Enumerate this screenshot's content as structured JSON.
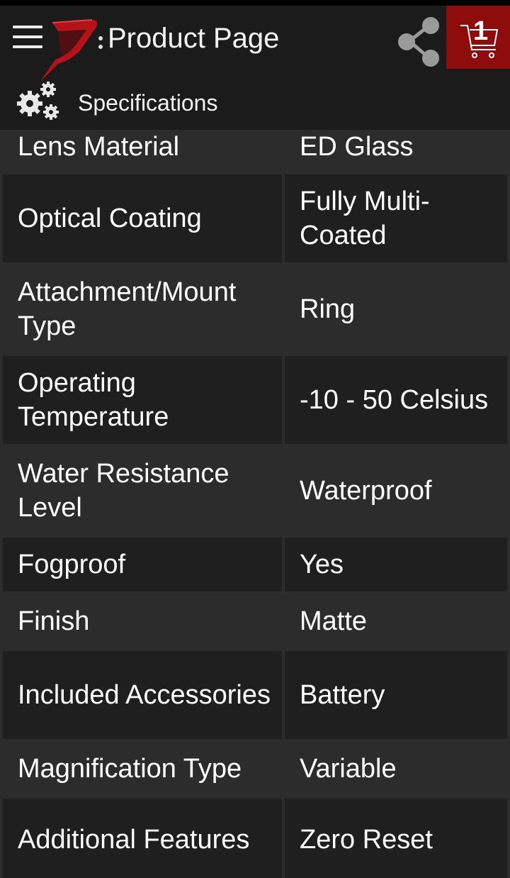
{
  "header": {
    "title": "Product Page",
    "subtitle": "Specifications",
    "cart_count": "1",
    "brand_color": "#8e0c0c"
  },
  "icons": {
    "menu": "hamburger-menu-icon",
    "logo": "brand-logo",
    "share": "share-icon",
    "cart": "shopping-cart-icon",
    "settings": "gears-icon"
  },
  "specs": [
    {
      "key": "Lens Material",
      "value": "ED Glass"
    },
    {
      "key": "Optical Coating",
      "value": "Fully Multi-Coated"
    },
    {
      "key": "Attachment/Mount Type",
      "value": "Ring"
    },
    {
      "key": "Operating Temperature",
      "value": "-10 - 50 Celsius"
    },
    {
      "key": "Water Resistance Level",
      "value": "Waterproof"
    },
    {
      "key": "Fogproof",
      "value": "Yes"
    },
    {
      "key": "Finish",
      "value": "Matte"
    },
    {
      "key": "Included Accessories",
      "value": "Battery"
    },
    {
      "key": "Magnification Type",
      "value": "Variable"
    },
    {
      "key": "Additional Features",
      "value": "Zero Reset"
    }
  ]
}
